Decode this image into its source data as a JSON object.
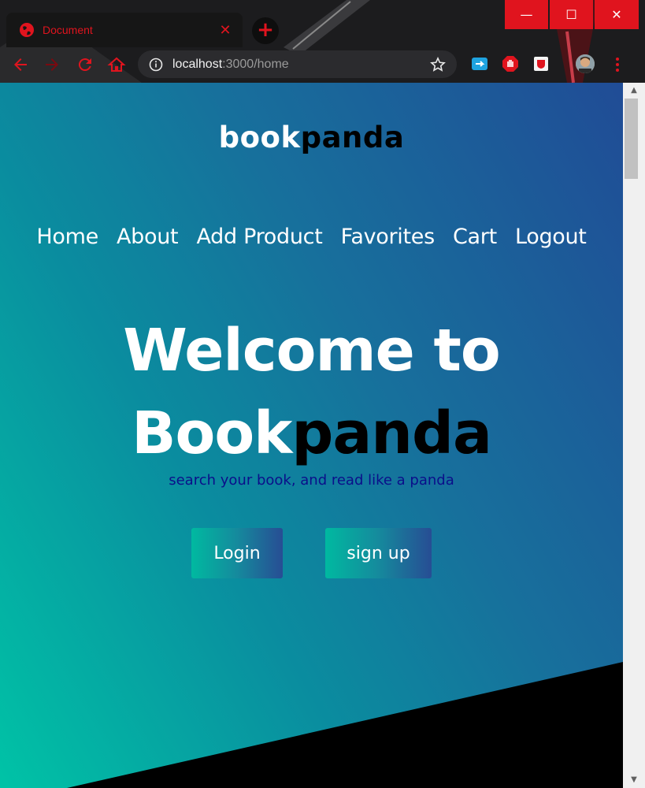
{
  "browser": {
    "tab_title": "Document",
    "tab_close_glyph": "✕",
    "new_tab_glyph": "+",
    "window_buttons": {
      "minimize": "—",
      "maximize": "☐",
      "close": "✕"
    },
    "url_host": "localhost",
    "url_path": ":3000/home",
    "accent_color": "#e0141e"
  },
  "page": {
    "logo": {
      "part1": "book",
      "part2": "panda"
    },
    "nav": [
      "Home",
      "About",
      "Add Product",
      "Favorites",
      "Cart",
      "Logout"
    ],
    "headline": {
      "line1": "Welcome to",
      "line2_light": "Book",
      "line2_dark": "panda"
    },
    "tagline": "search your book, and read like a panda",
    "buttons": {
      "login": "Login",
      "signup": "sign up"
    },
    "colors": {
      "gradient_start": "#00c3a6",
      "gradient_end": "#204c96",
      "tagline": "#0b0f8a"
    }
  },
  "scrollbar": {
    "up_glyph": "▲",
    "down_glyph": "▼"
  }
}
